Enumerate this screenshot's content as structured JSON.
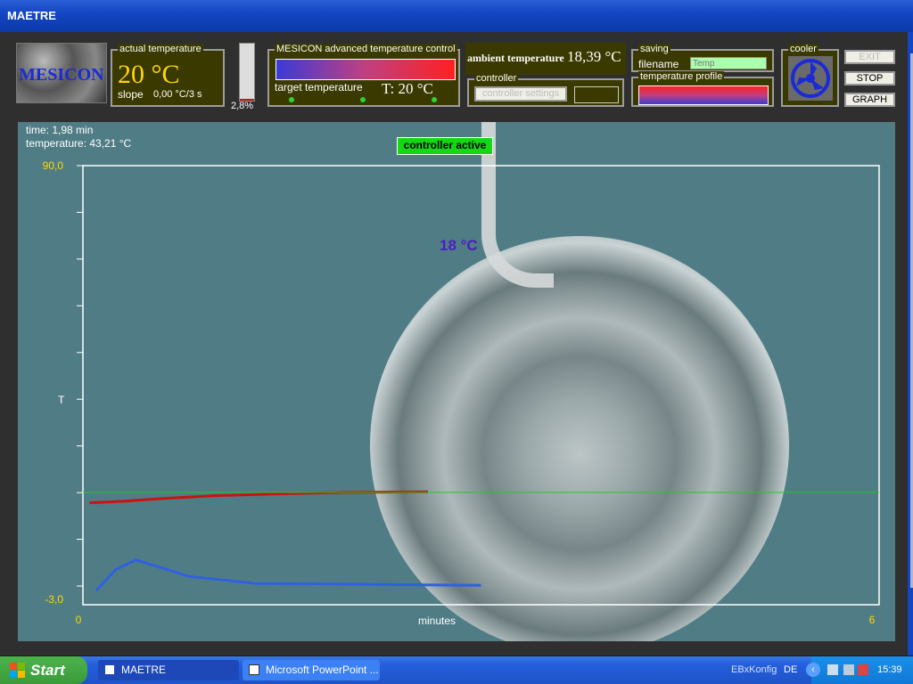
{
  "window": {
    "title": "MAETRE"
  },
  "logo": {
    "text": "MESICON"
  },
  "actual": {
    "legend": "actual temperature",
    "value": "20 °C",
    "slope_label": "slope",
    "slope_value": "0,00 °C/3 s"
  },
  "gauge": {
    "percent_text": "2,8%",
    "fill": 0.028
  },
  "control": {
    "legend": "MESICON advanced temperature control",
    "target_label": "target temperature",
    "target_value": "T: 20 °C"
  },
  "ambient": {
    "label": "ambient temperature",
    "value": "18,39 °C"
  },
  "controller": {
    "legend": "controller",
    "settings_button": "controller settings"
  },
  "saving": {
    "legend": "saving",
    "filename_label": "filename",
    "filename_placeholder": "Temp",
    "profile_legend": "temperature profile"
  },
  "cooler": {
    "legend": "cooler"
  },
  "buttons": {
    "exit": "EXIT",
    "stop": "STOP",
    "graph": "GRAPH"
  },
  "graph": {
    "time_text": "time: 1,98 min",
    "temp_text": "temperature: 43,21 °C",
    "status": "controller active",
    "marker_label": "18 °C",
    "y_axis_label": "T",
    "x_axis_label": "minutes"
  },
  "chart_data": {
    "type": "line",
    "xlabel": "minutes",
    "ylabel": "T",
    "xlim": [
      0,
      6
    ],
    "ylim": [
      -3.0,
      90.0
    ],
    "x_tick_labels": [
      "0",
      "6"
    ],
    "y_tick_labels": [
      "-3,0",
      "90,0"
    ],
    "grid": false,
    "series": [
      {
        "color": "#cc1111",
        "x": [
          0.05,
          0.3,
          0.6,
          1.0,
          1.5,
          2.0,
          2.6
        ],
        "y": [
          18.6,
          18.9,
          19.5,
          20.1,
          20.5,
          20.8,
          20.9
        ]
      },
      {
        "color": "#3060e0",
        "x": [
          0.1,
          0.25,
          0.4,
          0.8,
          1.3,
          1.9,
          2.6,
          3.0
        ],
        "y": [
          0.0,
          4.5,
          6.5,
          3.0,
          1.5,
          1.4,
          1.2,
          1.1
        ]
      },
      {
        "color": "#22cc22",
        "x": [
          0,
          6
        ],
        "y": [
          20.8,
          20.8
        ]
      }
    ]
  },
  "taskbar": {
    "start": "Start",
    "task1": "MAETRE",
    "task2": "Microsoft PowerPoint ...",
    "ebx": "EBxKonfig",
    "lang": "DE",
    "clock": "15:39"
  }
}
